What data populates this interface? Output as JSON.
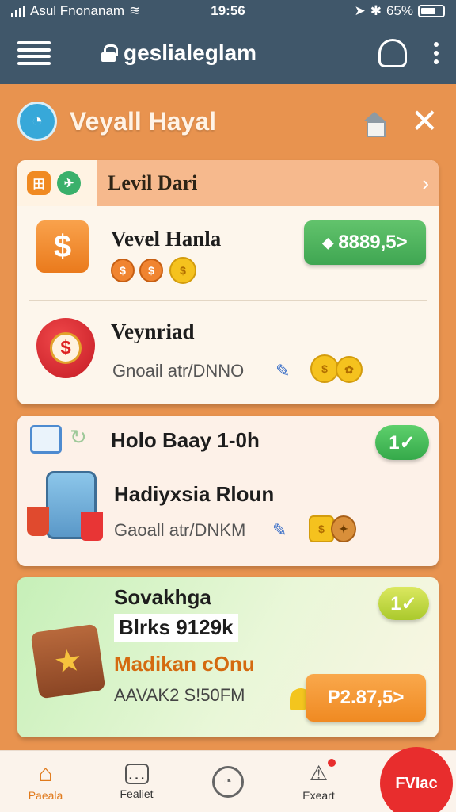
{
  "status": {
    "carrier": "Asul Fnonanam",
    "time": "19:56",
    "battery": "65%"
  },
  "appbar": {
    "title": "geslialeglam"
  },
  "header": {
    "title": "Veyall Hayal"
  },
  "card1": {
    "header_label": "Levil Dari",
    "row1": {
      "title": "Vevel Hanla",
      "button": "8889,5>"
    },
    "row2": {
      "title": "Veynriad",
      "subtitle": "Gnoail atr/DNNO"
    }
  },
  "card2": {
    "heading": "Holo Baay 1-0h",
    "title": "Hadiyxsia Rloun",
    "subtitle": "Gaoall atr/DNKM",
    "check": "1✓"
  },
  "card3": {
    "heading": "Sovakhga",
    "amount": "Blrks 9129k",
    "title": "Madikan cOnu",
    "subtitle": "AAVAK2 S!50FM",
    "check": "1✓",
    "button": "P2.87,5>"
  },
  "nav": {
    "home": "Paeala",
    "chat": "Fealiet",
    "timer": "",
    "alerts": "Exeart",
    "fab": "FVIac"
  },
  "colors": {
    "appbar": "#40576a",
    "background": "#e8934f",
    "green": "#3fa652",
    "orange": "#f08a22",
    "red": "#e82d2d"
  }
}
